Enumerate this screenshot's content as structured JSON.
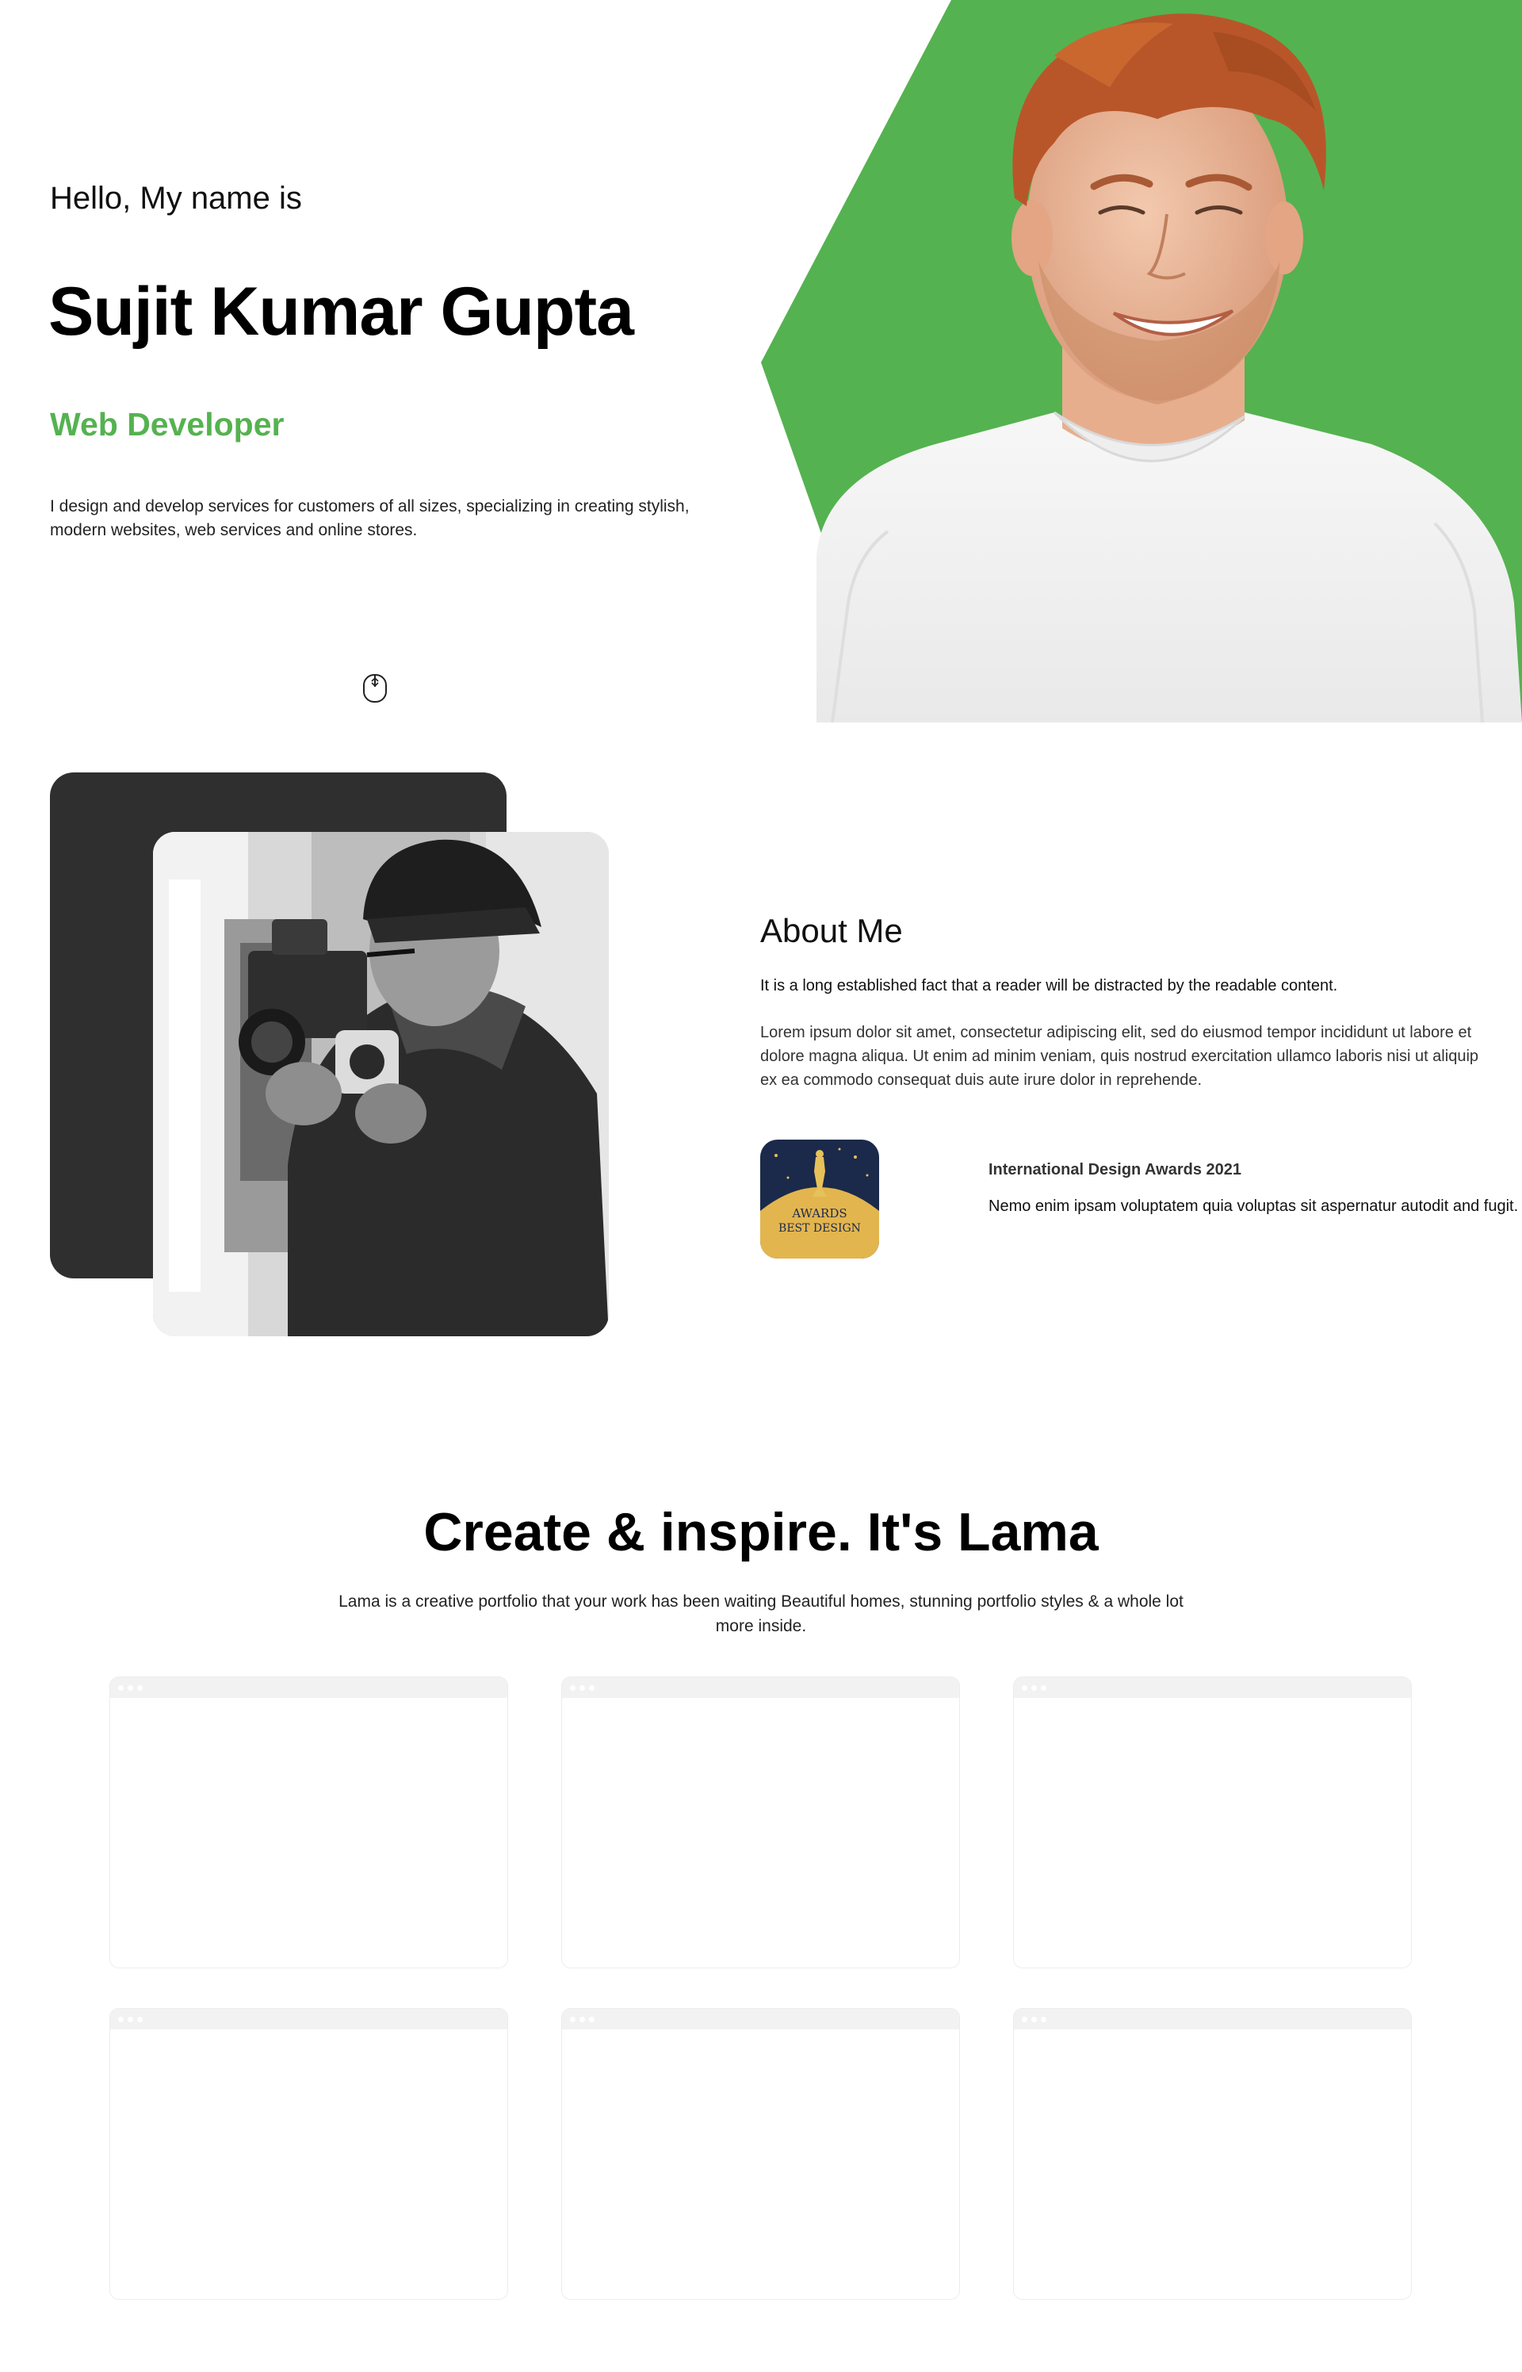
{
  "hero": {
    "greeting": "Hello, My name is",
    "name": "Sujit Kumar Gupta",
    "role": "Web Developer",
    "intro": "I design and develop services for customers of all sizes, specializing in creating stylish, modern websites, web services and online stores.",
    "scroll_icon": "mouse-scroll-icon",
    "accent_color": "#55b250"
  },
  "about": {
    "title": "About Me",
    "lead": "It is a long established fact that a reader will be distracted by the readable content.",
    "body": "Lorem ipsum dolor sit amet, consectetur adipiscing elit, sed do eiusmod tempor incididunt ut labore et dolore magna aliqua. Ut enim ad minim veniam, quis nostrud exercitation ullamco laboris nisi ut aliquip ex ea commodo consequat duis aute irure dolor in reprehende.",
    "award": {
      "badge_line1": "AWARDS",
      "badge_line2": "BEST DESIGN",
      "title": "International Design Awards 2021",
      "description": "Nemo enim ipsam voluptatem quia voluptas sit aspernatur autodit and fugit."
    }
  },
  "portfolio": {
    "title": "Create & inspire. It's Lama",
    "description": "Lama is a creative portfolio that your work has been waiting Beautiful homes, stunning portfolio styles & a whole lot more inside.",
    "item_count_visible": 6
  }
}
